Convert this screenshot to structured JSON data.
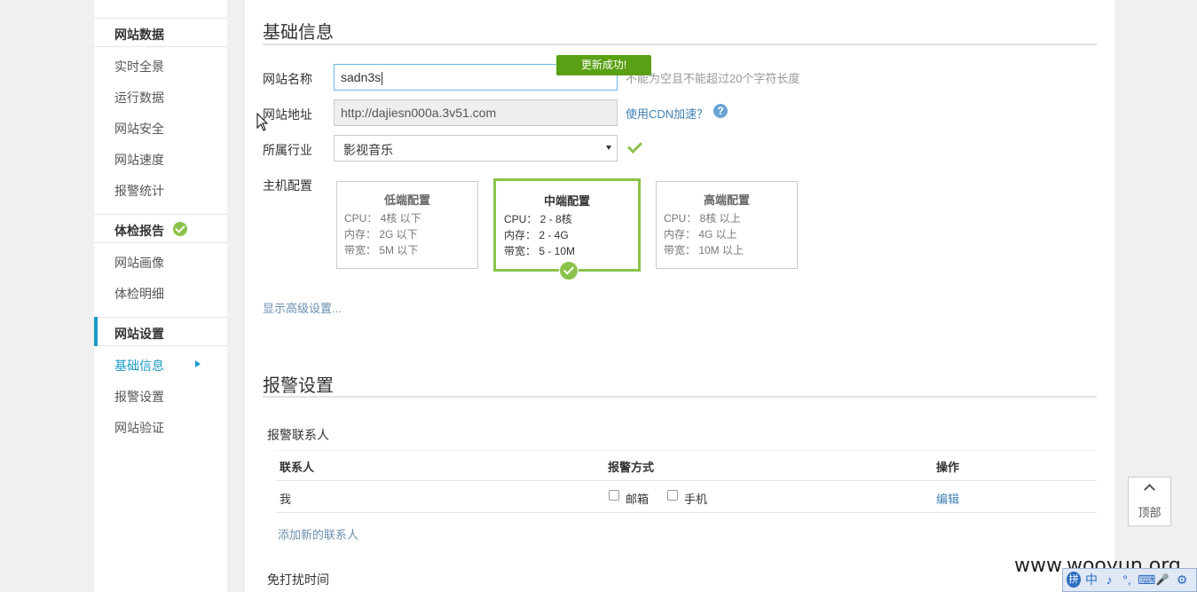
{
  "sidebar": {
    "groups": [
      {
        "label": "网站数据",
        "items": [
          "实时全景",
          "运行数据",
          "网站安全",
          "网站速度",
          "报警统计"
        ]
      },
      {
        "label": "体检报告",
        "items": [
          "网站画像",
          "体检明细"
        ]
      },
      {
        "label": "网站设置",
        "items": [
          "基础信息",
          "报警设置",
          "网站验证"
        ]
      }
    ],
    "active_item": "基础信息"
  },
  "basic_info": {
    "title": "基础信息",
    "site_name_label": "网站名称",
    "site_name_value": "sadn3s",
    "site_name_hint": "不能为空且不能超过20个字符长度",
    "site_url_label": "网站地址",
    "site_url_value": "http://dajiesn000a.3v51.com",
    "cdn_link": "使用CDN加速？",
    "help_glyph": "?",
    "industry_label": "所属行业",
    "industry_value": "影视音乐",
    "host_label": "主机配置",
    "toast": "更新成功!",
    "advanced_link": "显示高级设置...",
    "configs": [
      {
        "title": "低端配置",
        "cpu": "CPU：  4核 以下",
        "mem": "内存：  2G 以下",
        "bw": "带宽：  5M 以下",
        "selected": false
      },
      {
        "title": "中端配置",
        "cpu": "CPU：  2 - 8核",
        "mem": "内存：  2 - 4G",
        "bw": "带宽：  5 - 10M",
        "selected": true
      },
      {
        "title": "高端配置",
        "cpu": "CPU：  8核 以上",
        "mem": "内存：  4G 以上",
        "bw": "带宽：  10M 以上",
        "selected": false
      }
    ]
  },
  "alert_settings": {
    "title": "报警设置",
    "contacts_label": "报警联系人",
    "columns": [
      "联系人",
      "报警方式",
      "操作"
    ],
    "rows": [
      {
        "contact": "我",
        "method_email": "邮箱",
        "method_phone": "手机",
        "action": "编辑"
      }
    ],
    "add_contact": "添加新的联系人",
    "quiet_time_label": "免打扰时间"
  },
  "back_to_top": "顶部",
  "watermark": "www.wooyun.org",
  "ime": {
    "icons": [
      "拼",
      "中",
      "♪",
      "°,",
      "⌨",
      "🎤",
      "⚙"
    ]
  },
  "colors": {
    "accent": "#1a9bc7",
    "success": "#8bc34a",
    "toast": "#5aa014",
    "link": "#3e7fb3"
  }
}
